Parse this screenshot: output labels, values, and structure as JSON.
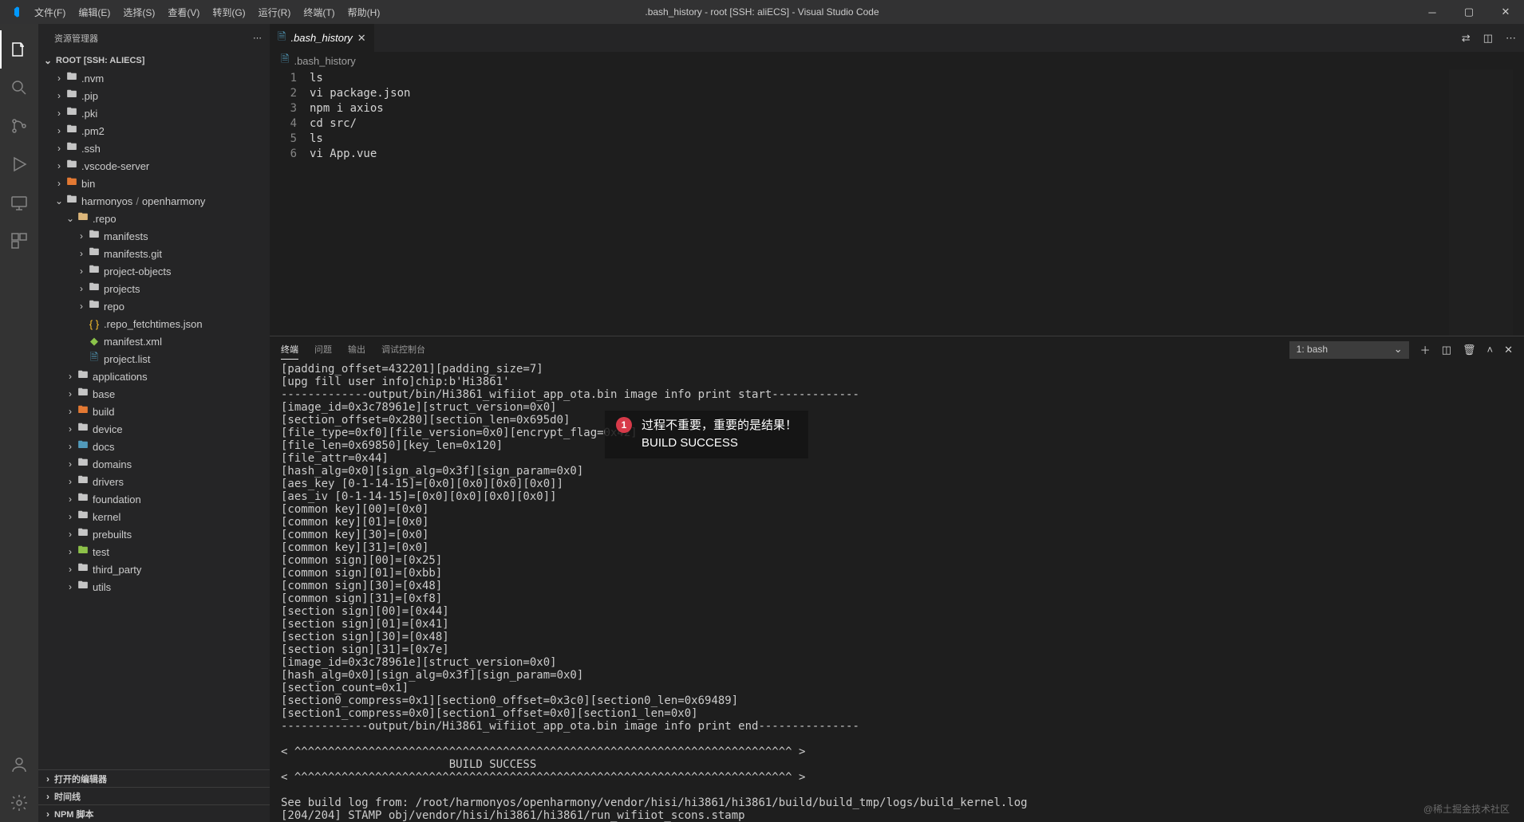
{
  "titlebar": {
    "title": ".bash_history - root [SSH: aliECS] - Visual Studio Code"
  },
  "menu": {
    "items": [
      "文件(F)",
      "编辑(E)",
      "选择(S)",
      "查看(V)",
      "转到(G)",
      "运行(R)",
      "终端(T)",
      "帮助(H)"
    ]
  },
  "sidebar": {
    "title": "资源管理器",
    "root": "ROOT [SSH: ALIECS]",
    "top_items": [
      {
        "name": ".nvm",
        "indent": 1
      },
      {
        "name": ".pip",
        "indent": 1
      },
      {
        "name": ".pki",
        "indent": 1
      },
      {
        "name": ".pm2",
        "indent": 1
      },
      {
        "name": ".ssh",
        "indent": 1
      },
      {
        "name": ".vscode-server",
        "indent": 1
      }
    ],
    "bin": {
      "name": "bin",
      "indent": 1,
      "color": "orange"
    },
    "harmonyos": {
      "label": "harmonyos",
      "sub": "openharmony"
    },
    "repo_items": [
      {
        "name": ".repo",
        "indent": 2,
        "expanded": true,
        "color": "orange"
      },
      {
        "name": "manifests",
        "indent": 3
      },
      {
        "name": "manifests.git",
        "indent": 3
      },
      {
        "name": "project-objects",
        "indent": 3
      },
      {
        "name": "projects",
        "indent": 3
      },
      {
        "name": "repo",
        "indent": 3
      }
    ],
    "repo_files": [
      {
        "name": ".repo_fetchtimes.json",
        "icon": "json"
      },
      {
        "name": "manifest.xml",
        "icon": "xml"
      },
      {
        "name": "project.list",
        "icon": "txt"
      }
    ],
    "harmony_folders": [
      {
        "name": "applications"
      },
      {
        "name": "base"
      },
      {
        "name": "build",
        "color": "orange"
      },
      {
        "name": "device"
      },
      {
        "name": "docs",
        "color": "blue"
      },
      {
        "name": "domains"
      },
      {
        "name": "drivers"
      },
      {
        "name": "foundation"
      },
      {
        "name": "kernel"
      },
      {
        "name": "prebuilts"
      },
      {
        "name": "test",
        "color": "green"
      },
      {
        "name": "third_party"
      },
      {
        "name": "utils"
      }
    ],
    "sections": [
      {
        "label": "打开的编辑器"
      },
      {
        "label": "时间线"
      },
      {
        "label": "NPM 脚本"
      }
    ]
  },
  "editor": {
    "tab_name": ".bash_history",
    "breadcrumb": ".bash_history",
    "lines": [
      {
        "n": "1",
        "t": "ls"
      },
      {
        "n": "2",
        "t": "vi package.json"
      },
      {
        "n": "3",
        "t": "npm i axios"
      },
      {
        "n": "4",
        "t": "cd src/"
      },
      {
        "n": "5",
        "t": "ls"
      },
      {
        "n": "6",
        "t": "vi App.vue"
      }
    ]
  },
  "panel": {
    "tabs": [
      "终端",
      "问题",
      "输出",
      "调试控制台"
    ],
    "terminal_selector": "1: bash",
    "terminal_output": "[padding_offset=432201][padding_size=7]\n[upg fill user info]chip:b'Hi3861'\n-------------output/bin/Hi3861_wifiiot_app_ota.bin image info print start-------------\n[image_id=0x3c78961e][struct_version=0x0]\n[section_offset=0x280][section_len=0x695d0]\n[file_type=0xf0][file_version=0x0][encrypt_flag=0x42]\n[file_len=0x69850][key_len=0x120]\n[file_attr=0x44]\n[hash_alg=0x0][sign_alg=0x3f][sign_param=0x0]\n[aes_key [0-1-14-15]=[0x0][0x0][0x0][0x0]]\n[aes_iv [0-1-14-15]=[0x0][0x0][0x0][0x0]]\n[common key][00]=[0x0]\n[common key][01]=[0x0]\n[common key][30]=[0x0]\n[common key][31]=[0x0]\n[common sign][00]=[0x25]\n[common sign][01]=[0xbb]\n[common sign][30]=[0x48]\n[common sign][31]=[0xf8]\n[section sign][00]=[0x44]\n[section sign][01]=[0x41]\n[section sign][30]=[0x48]\n[section sign][31]=[0x7e]\n[image_id=0x3c78961e][struct_version=0x0]\n[hash_alg=0x0][sign_alg=0x3f][sign_param=0x0]\n[section_count=0x1]\n[section0_compress=0x1][section0_offset=0x3c0][section0_len=0x69489]\n[section1_compress=0x0][section1_offset=0x0][section1_len=0x0]\n-------------output/bin/Hi3861_wifiiot_app_ota.bin image info print end---------------\n\n< ^^^^^^^^^^^^^^^^^^^^^^^^^^^^^^^^^^^^^^^^^^^^^^^^^^^^^^^^^^^^^^^^^^^^^^^^^^ >\n                         BUILD SUCCESS\n< ^^^^^^^^^^^^^^^^^^^^^^^^^^^^^^^^^^^^^^^^^^^^^^^^^^^^^^^^^^^^^^^^^^^^^^^^^^ >\n\nSee build log from: /root/harmonyos/openharmony/vendor/hisi/hi3861/hi3861/build/build_tmp/logs/build_kernel.log\n[204/204] STAMP obj/vendor/hisi/hi3861/hi3861/run_wifiiot_scons.stamp\nohos wifiiot build success!"
  },
  "annotation": {
    "badge": "1",
    "line1": "过程不重要，重要的是结果！",
    "line2": "BUILD SUCCESS"
  },
  "watermark": "@稀土掘金技术社区"
}
